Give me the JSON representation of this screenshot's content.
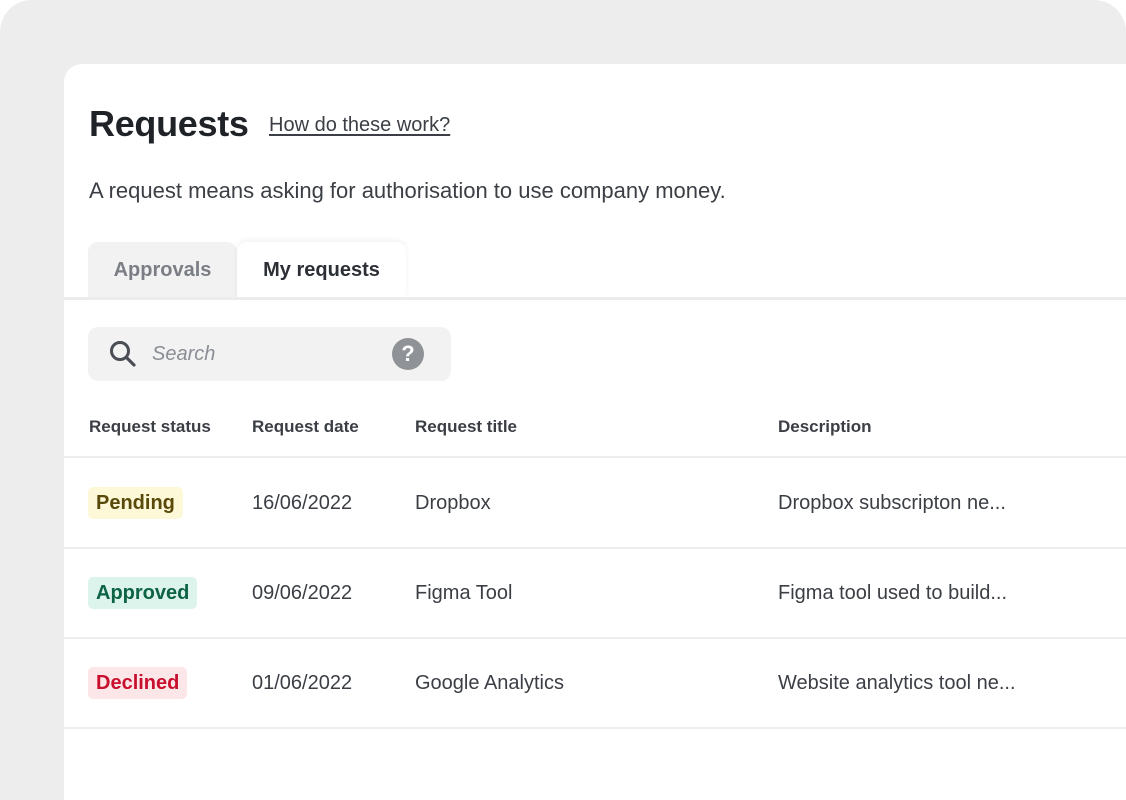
{
  "header": {
    "title": "Requests",
    "help_link": "How do these work?",
    "subtitle": "A request means asking for authorisation to use company money."
  },
  "tabs": [
    {
      "label": "Approvals",
      "active": false
    },
    {
      "label": "My requests",
      "active": true
    }
  ],
  "search": {
    "placeholder": "Search",
    "value": "",
    "icon": "search-icon",
    "help_icon": "question-circle-icon",
    "help_glyph": "?"
  },
  "table": {
    "columns": [
      "Request status",
      "Request date",
      "Request title",
      "Description"
    ],
    "rows": [
      {
        "status": "Pending",
        "status_bg": "#fdf9d8",
        "status_color": "#5a4a0a",
        "date": "16/06/2022",
        "title": "Dropbox",
        "description": "Dropbox subscripton ne..."
      },
      {
        "status": "Approved",
        "status_bg": "#dcf4ec",
        "status_color": "#0c6444",
        "date": "09/06/2022",
        "title": "Figma Tool",
        "description": "Figma tool used to build..."
      },
      {
        "status": "Declined",
        "status_bg": "#fde6e8",
        "status_color": "#c8102e",
        "date": "01/06/2022",
        "title": "Google Analytics",
        "description": "Website analytics tool ne..."
      }
    ]
  },
  "colors": {
    "frame_bg": "#ededed",
    "panel_bg": "#ffffff",
    "text_primary": "#1f2328",
    "text_secondary": "#3b3f45",
    "tab_inactive_bg": "#f2f2f2"
  }
}
